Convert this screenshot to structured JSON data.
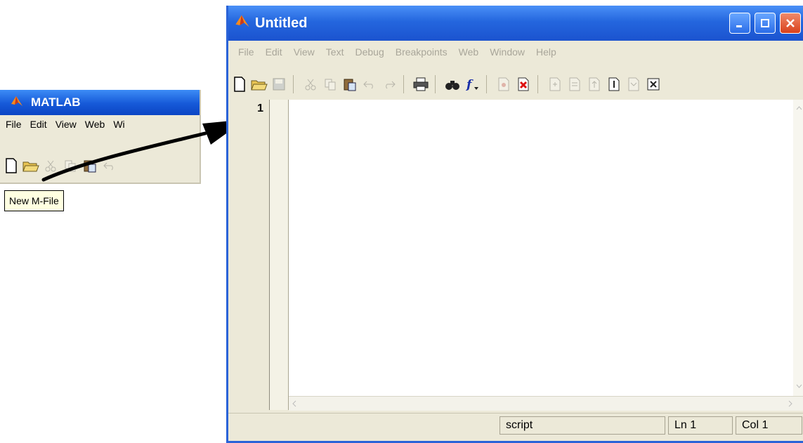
{
  "matlab_window": {
    "title": "MATLAB",
    "menu": [
      "File",
      "Edit",
      "View",
      "Web",
      "Wi"
    ],
    "toolbar_icons": [
      "new-file-icon",
      "open-folder-icon",
      "cut-icon",
      "copy-icon",
      "paste-icon",
      "undo-icon"
    ],
    "tooltip": "New M-File"
  },
  "editor_window": {
    "title": "Untitled",
    "menu": [
      "File",
      "Edit",
      "View",
      "Text",
      "Debug",
      "Breakpoints",
      "Web",
      "Window",
      "Help"
    ],
    "line_number": "1",
    "status": {
      "mode": "script",
      "line": "Ln 1",
      "col": "Col 1"
    }
  },
  "colors": {
    "title_blue": "#2466de",
    "close_red": "#d9411b",
    "tooltip_bg": "#ffffe1",
    "window_bg": "#ece9d8"
  }
}
